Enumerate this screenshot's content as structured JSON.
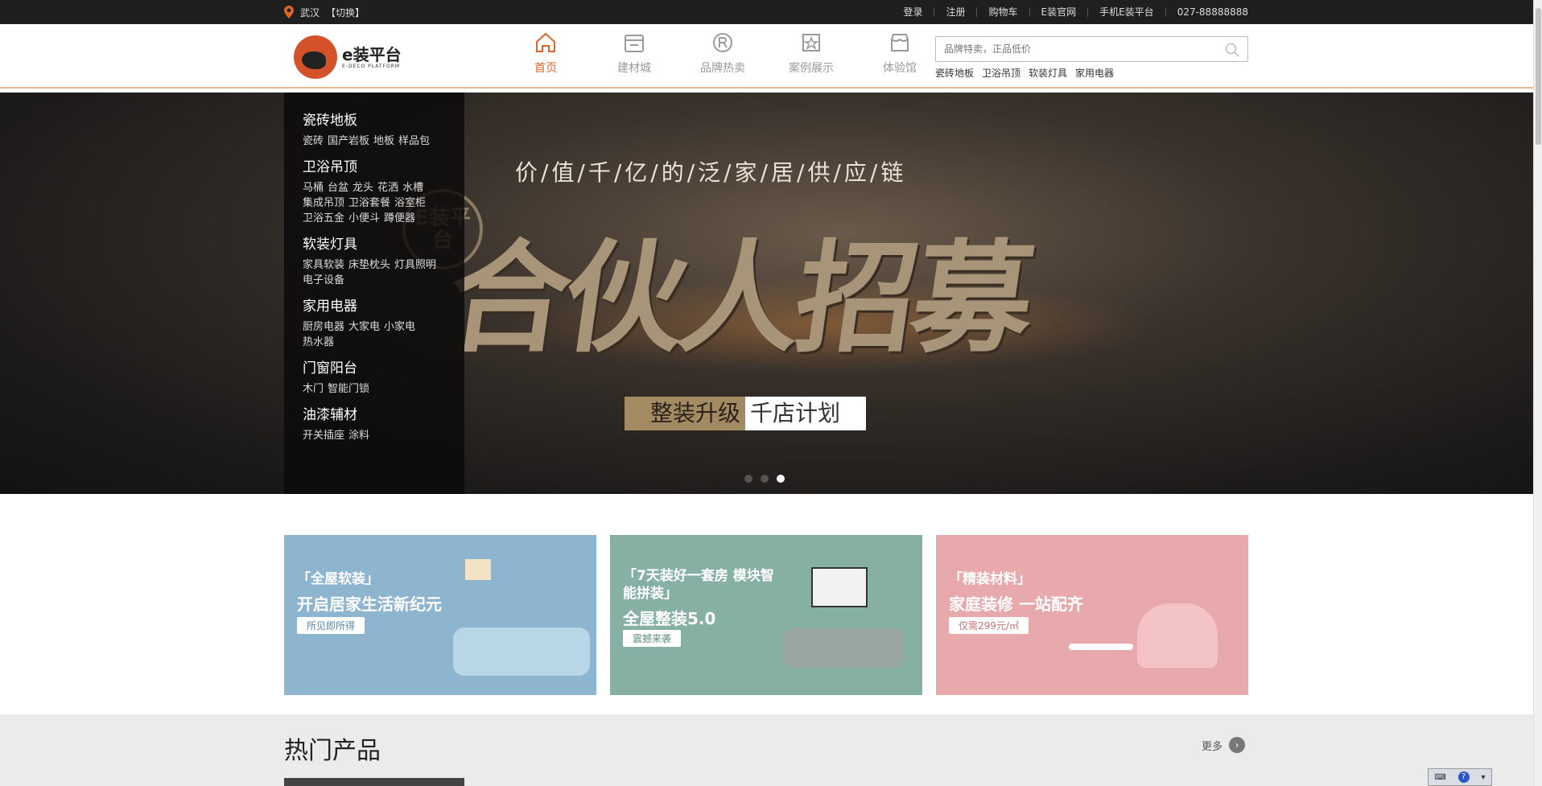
{
  "topbar": {
    "location": "武汉",
    "switch": "【切换】",
    "links": [
      "登录",
      "注册",
      "购物车",
      "E装官网",
      "手机E装平台",
      "027-88888888"
    ]
  },
  "logo": {
    "name": "e装平台",
    "sub": "E-DECO PLATFORM"
  },
  "nav": [
    {
      "label": "首页",
      "icon": "home-icon",
      "active": true
    },
    {
      "label": "建材城",
      "icon": "store-icon",
      "active": false
    },
    {
      "label": "品牌热卖",
      "icon": "registered-icon",
      "active": false
    },
    {
      "label": "案例展示",
      "icon": "star-frame-icon",
      "active": false
    },
    {
      "label": "体验馆",
      "icon": "shop-icon",
      "active": false
    }
  ],
  "search": {
    "placeholder": "品牌特卖，正品低价"
  },
  "hotwords": [
    "瓷砖地板",
    "卫浴吊顶",
    "软装灯具",
    "家用电器"
  ],
  "categories": [
    {
      "title": "瓷砖地板",
      "items": [
        "瓷砖",
        "国产岩板",
        "地板",
        "样品包"
      ]
    },
    {
      "title": "卫浴吊顶",
      "items": [
        "马桶",
        "台盆",
        "龙头",
        "花洒",
        "水槽",
        "集成吊顶",
        "卫浴套餐",
        "浴室柜",
        "卫浴五金",
        "小便斗",
        "蹲便器"
      ]
    },
    {
      "title": "软装灯具",
      "items": [
        "家具软装",
        "床垫枕头",
        "灯具照明",
        "电子设备"
      ]
    },
    {
      "title": "家用电器",
      "items": [
        "厨房电器",
        "大家电",
        "小家电",
        "热水器"
      ]
    },
    {
      "title": "门窗阳台",
      "items": [
        "木门",
        "智能门锁"
      ]
    },
    {
      "title": "油漆辅材",
      "items": [
        "开关插座",
        "涂料"
      ]
    }
  ],
  "hero": {
    "slogan": "价/值/千/亿/的/泛/家/居/供/应/链",
    "big": "合伙人招募",
    "seal": "E装平台",
    "tag_a": "整装升级",
    "tag_b": "千店计划",
    "slide_count": 3,
    "active_slide": 3
  },
  "promos": [
    {
      "t1": "「全屋软装」",
      "t2": "开启居家生活新纪元",
      "pill": "所见即所得",
      "color": "#8db5cf"
    },
    {
      "t1": "「7天装好一套房 模块智能拼装」",
      "t2": "全屋整装5.0",
      "pill": "震撼来袭",
      "color": "#85b0a3"
    },
    {
      "t1": "「精装材料」",
      "t2": "家庭装修 一站配齐",
      "pill": "仅需299元/㎡",
      "color": "#e8a9ac"
    }
  ],
  "hot": {
    "title": "热门产品",
    "more": "更多"
  },
  "colors": {
    "accent": "#e0642a",
    "topbar": "#1f1f1f"
  }
}
